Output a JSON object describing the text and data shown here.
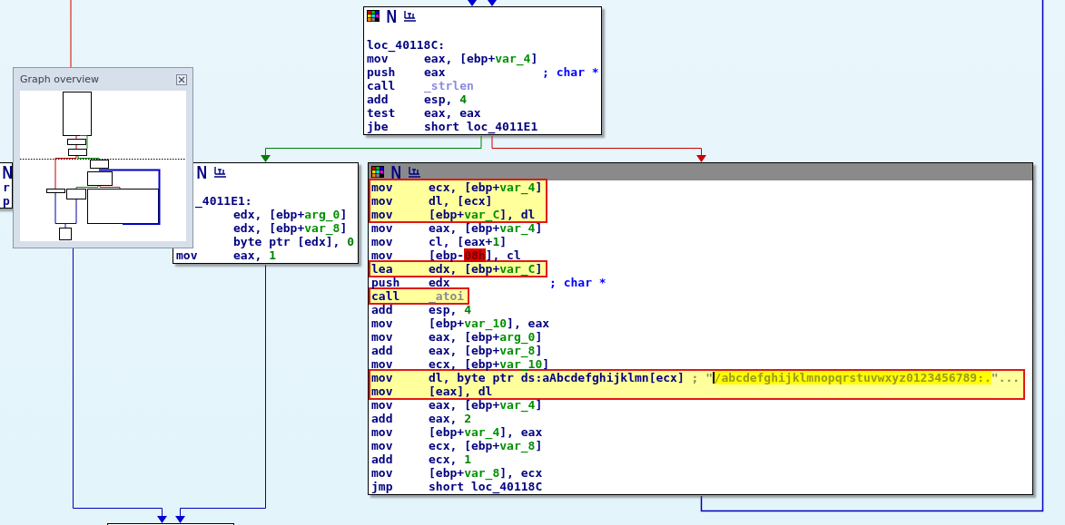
{
  "graph_nodes": [
    {
      "selected": false,
      "icons": [
        {
          "kind": "palette"
        },
        {
          "kind": "text",
          "text": "N"
        },
        {
          "kind": "graph"
        }
      ],
      "lines": [
        {
          "label": "loc_40118C:"
        },
        {
          "mnemonic": "mov",
          "operands": [
            {
              "text": "eax, [ebp+",
              "kind": "text"
            },
            {
              "text": "var_4",
              "kind": "name"
            },
            {
              "text": "]",
              "kind": "text"
            }
          ]
        },
        {
          "mnemonic": "push",
          "operands": [
            {
              "text": "eax",
              "kind": "text"
            }
          ],
          "comment": "; char *"
        },
        {
          "mnemonic": "call",
          "operands": [
            {
              "text": "_strlen",
              "kind": "import"
            }
          ]
        },
        {
          "mnemonic": "add",
          "operands": [
            {
              "text": "esp, ",
              "kind": "text"
            },
            {
              "text": "4",
              "kind": "number"
            }
          ]
        },
        {
          "mnemonic": "test",
          "operands": [
            {
              "text": "eax, eax",
              "kind": "text"
            }
          ]
        },
        {
          "mnemonic": "jbe",
          "operands": [
            {
              "text": "short loc_4011E1",
              "kind": "text"
            }
          ]
        }
      ]
    },
    {
      "selected": false,
      "icons": [
        {
          "kind": "text",
          "text": "N"
        }
      ],
      "lines": [
        {
          "mnemonic": "r"
        },
        {
          "mnemonic": "p"
        }
      ]
    },
    {
      "selected": false,
      "icons": [
        {
          "kind": "text",
          "text": "N"
        },
        {
          "kind": "graph"
        }
      ],
      "lines": [
        {
          "label": "_4011E1:"
        },
        {
          "operands": [
            {
              "text": "edx, [ebp+",
              "kind": "text"
            },
            {
              "text": "arg_0",
              "kind": "name"
            },
            {
              "text": "]",
              "kind": "text"
            }
          ]
        },
        {
          "operands": [
            {
              "text": "edx, [ebp+",
              "kind": "text"
            },
            {
              "text": "var_8",
              "kind": "name"
            },
            {
              "text": "]",
              "kind": "text"
            }
          ]
        },
        {
          "operands": [
            {
              "text": "byte ptr [edx], ",
              "kind": "text"
            },
            {
              "text": "0",
              "kind": "number"
            }
          ]
        },
        {
          "mnemonic": "mov",
          "operands": [
            {
              "text": "eax, ",
              "kind": "text"
            },
            {
              "text": "1",
              "kind": "number"
            }
          ]
        }
      ]
    },
    {
      "selected": true,
      "icons": [
        {
          "kind": "palette"
        },
        {
          "kind": "text",
          "text": "N"
        },
        {
          "kind": "graph"
        }
      ],
      "lines": [
        {
          "mnemonic": "mov",
          "marked": true,
          "operands": [
            {
              "text": "ecx, [ebp+",
              "kind": "text"
            },
            {
              "text": "var_4",
              "kind": "name"
            },
            {
              "text": "]",
              "kind": "text"
            }
          ]
        },
        {
          "mnemonic": "mov",
          "marked": true,
          "operands": [
            {
              "text": "dl, [ecx]",
              "kind": "text"
            }
          ]
        },
        {
          "mnemonic": "mov",
          "marked": true,
          "operands": [
            {
              "text": "[ebp+",
              "kind": "text"
            },
            {
              "text": "var_C",
              "kind": "name"
            },
            {
              "text": "], dl",
              "kind": "text"
            }
          ]
        },
        {
          "mnemonic": "mov",
          "marked": false,
          "operands": [
            {
              "text": "eax, [ebp+",
              "kind": "text"
            },
            {
              "text": "var_4",
              "kind": "name"
            },
            {
              "text": "]",
              "kind": "text"
            }
          ]
        },
        {
          "mnemonic": "mov",
          "marked": false,
          "operands": [
            {
              "text": "cl, [eax+",
              "kind": "text"
            },
            {
              "text": "1",
              "kind": "number"
            },
            {
              "text": "]",
              "kind": "text"
            }
          ]
        },
        {
          "mnemonic": "mov",
          "marked": false,
          "operands": [
            {
              "text": "[ebp-",
              "kind": "text"
            },
            {
              "text": "08h",
              "kind": "error"
            },
            {
              "text": "], cl",
              "kind": "text"
            }
          ]
        },
        {
          "mnemonic": "lea",
          "marked": true,
          "operands": [
            {
              "text": "edx, [ebp+",
              "kind": "text"
            },
            {
              "text": "var_C",
              "kind": "name"
            },
            {
              "text": "]",
              "kind": "text"
            }
          ]
        },
        {
          "mnemonic": "push",
          "marked": false,
          "operands": [
            {
              "text": "edx",
              "kind": "text"
            }
          ],
          "comment": "; char *"
        },
        {
          "mnemonic": "call",
          "marked": true,
          "operands": [
            {
              "text": "_atoi",
              "kind": "library"
            }
          ]
        },
        {
          "mnemonic": "add",
          "marked": false,
          "operands": [
            {
              "text": "esp, ",
              "kind": "text"
            },
            {
              "text": "4",
              "kind": "number"
            }
          ]
        },
        {
          "mnemonic": "mov",
          "marked": false,
          "operands": [
            {
              "text": "[ebp+",
              "kind": "text"
            },
            {
              "text": "var_10",
              "kind": "name"
            },
            {
              "text": "], eax",
              "kind": "text"
            }
          ]
        },
        {
          "mnemonic": "mov",
          "marked": false,
          "operands": [
            {
              "text": "eax, [ebp+",
              "kind": "text"
            },
            {
              "text": "arg_0",
              "kind": "name"
            },
            {
              "text": "]",
              "kind": "text"
            }
          ]
        },
        {
          "mnemonic": "add",
          "marked": false,
          "operands": [
            {
              "text": "eax, [ebp+",
              "kind": "text"
            },
            {
              "text": "var_8",
              "kind": "name"
            },
            {
              "text": "]",
              "kind": "text"
            }
          ]
        },
        {
          "mnemonic": "mov",
          "marked": false,
          "operands": [
            {
              "text": "ecx, [ebp+",
              "kind": "text"
            },
            {
              "text": "var_10",
              "kind": "name"
            },
            {
              "text": "]",
              "kind": "text"
            }
          ]
        },
        {
          "mnemonic": "mov",
          "marked": true,
          "operands": [
            {
              "text": "dl, byte ptr ds:aAbcdefghijklmn[ecx] ",
              "kind": "text"
            },
            {
              "text": "; \"",
              "kind": "string"
            },
            {
              "text": "/abcdefghijklmnopqrstuvwxyz0123456789:.",
              "kind": "cursor_string"
            },
            {
              "text": "\"...",
              "kind": "string"
            }
          ]
        },
        {
          "mnemonic": "mov",
          "marked": true,
          "operands": [
            {
              "text": "[eax], dl",
              "kind": "text"
            }
          ]
        },
        {
          "mnemonic": "mov",
          "marked": false,
          "operands": [
            {
              "text": "eax, [ebp+",
              "kind": "text"
            },
            {
              "text": "var_4",
              "kind": "name"
            },
            {
              "text": "]",
              "kind": "text"
            }
          ]
        },
        {
          "mnemonic": "add",
          "marked": false,
          "operands": [
            {
              "text": "eax, ",
              "kind": "text"
            },
            {
              "text": "2",
              "kind": "number"
            }
          ]
        },
        {
          "mnemonic": "mov",
          "marked": false,
          "operands": [
            {
              "text": "[ebp+",
              "kind": "text"
            },
            {
              "text": "var_4",
              "kind": "name"
            },
            {
              "text": "], eax",
              "kind": "text"
            }
          ]
        },
        {
          "mnemonic": "mov",
          "marked": false,
          "operands": [
            {
              "text": "ecx, [ebp+",
              "kind": "text"
            },
            {
              "text": "var_8",
              "kind": "name"
            },
            {
              "text": "]",
              "kind": "text"
            }
          ]
        },
        {
          "mnemonic": "add",
          "marked": false,
          "operands": [
            {
              "text": "ecx, ",
              "kind": "text"
            },
            {
              "text": "1",
              "kind": "number"
            }
          ]
        },
        {
          "mnemonic": "mov",
          "marked": false,
          "operands": [
            {
              "text": "[ebp+",
              "kind": "text"
            },
            {
              "text": "var_8",
              "kind": "name"
            },
            {
              "text": "], ecx",
              "kind": "text"
            }
          ]
        },
        {
          "mnemonic": "jmp",
          "marked": false,
          "operands": [
            {
              "text": "short loc_40118C",
              "kind": "text"
            }
          ]
        }
      ]
    }
  ],
  "overview": {
    "title": "Graph overview"
  }
}
